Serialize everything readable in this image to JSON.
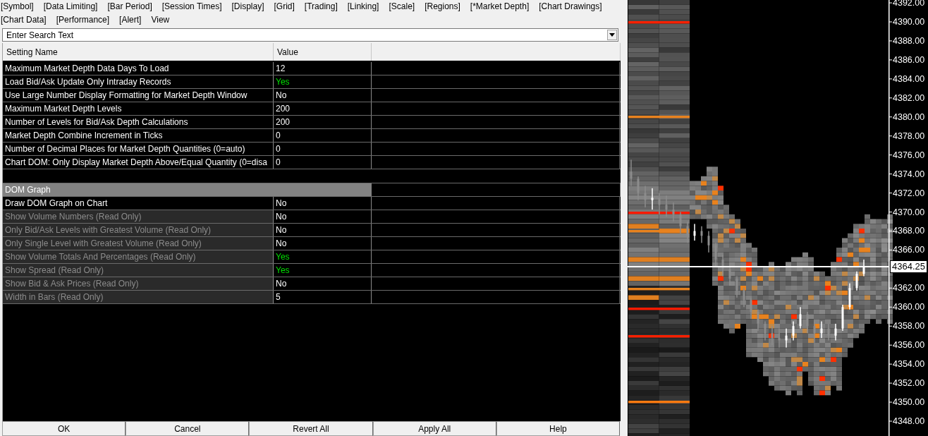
{
  "menu": {
    "rows": [
      [
        "[Symbol]",
        "[Data Limiting]",
        "[Bar Period]",
        "[Session Times]",
        "[Display]",
        "[Grid]",
        "[Trading]",
        "[Linking]",
        "[Scale]",
        "[Regions]",
        "[*Market Depth]",
        "[Chart Drawings]"
      ],
      [
        "[Chart Data]",
        "[Performance]",
        "[Alert]",
        "View"
      ]
    ]
  },
  "search": {
    "placeholder": "Enter Search Text"
  },
  "table": {
    "columns": [
      "Setting Name",
      "Value"
    ],
    "sections": [
      {
        "settings": [
          {
            "name": "Maximum Market Depth Data Days To Load",
            "value": "12",
            "color": "#ffffff",
            "read_only": false
          },
          {
            "name": "Load Bid/Ask Update Only Intraday Records",
            "value": "Yes",
            "color": "#00e000",
            "read_only": false
          },
          {
            "name": "Use Large Number Display Formatting for Market Depth Window",
            "value": "No",
            "color": "#ffffff",
            "read_only": false
          },
          {
            "name": "Maximum Market Depth Levels",
            "value": "200",
            "color": "#ffffff",
            "read_only": false
          },
          {
            "name": "Number of Levels for Bid/Ask Depth Calculations",
            "value": "200",
            "color": "#ffffff",
            "read_only": false
          },
          {
            "name": "Market Depth Combine Increment in Ticks",
            "value": "0",
            "color": "#ffffff",
            "read_only": false
          },
          {
            "name": "Number of Decimal Places for Market Depth Quantities (0=auto)",
            "value": "0",
            "color": "#ffffff",
            "read_only": false
          },
          {
            "name": "Chart DOM: Only Display Market Depth Above/Equal Quantity (0=disa",
            "value": "0",
            "color": "#ffffff",
            "read_only": false
          }
        ]
      },
      {
        "title": "DOM Graph",
        "settings": [
          {
            "name": "Draw DOM Graph on Chart",
            "value": "No",
            "color": "#ffffff",
            "read_only": false
          },
          {
            "name": "Show Volume Numbers (Read Only)",
            "value": "No",
            "color": "#ffffff",
            "read_only": true
          },
          {
            "name": "Only Bid/Ask Levels with Greatest Volume (Read Only)",
            "value": "No",
            "color": "#ffffff",
            "read_only": true
          },
          {
            "name": "Only Single Level with Greatest Volume (Read Only)",
            "value": "No",
            "color": "#ffffff",
            "read_only": true
          },
          {
            "name": "Show Volume Totals And Percentages (Read Only)",
            "value": "Yes",
            "color": "#00e000",
            "read_only": true
          },
          {
            "name": "Show Spread (Read Only)",
            "value": "Yes",
            "color": "#00e000",
            "read_only": true
          },
          {
            "name": "Show Bid & Ask Prices (Read Only)",
            "value": "No",
            "color": "#ffffff",
            "read_only": true
          },
          {
            "name": "Width in Bars (Read Only)",
            "value": "5",
            "color": "#ffffff",
            "read_only": true
          }
        ]
      }
    ]
  },
  "buttons": [
    "OK",
    "Cancel",
    "Revert All",
    "Apply All",
    "Help"
  ],
  "chart": {
    "chart_data": {
      "type": "candlestick",
      "ylim": [
        4346.44,
        4392.3
      ],
      "ref_lines": [
        {
          "axis": "y",
          "value": 4364.25,
          "label": "4364.25",
          "color": "#ffffff"
        }
      ],
      "yticks": [
        {
          "value": 4392,
          "label": "4392.00"
        },
        {
          "value": 4390,
          "label": "4390.00"
        },
        {
          "value": 4388,
          "label": "4388.00"
        },
        {
          "value": 4386,
          "label": "4386.00"
        },
        {
          "value": 4384,
          "label": "4384.00"
        },
        {
          "value": 4382,
          "label": "4382.00"
        },
        {
          "value": 4380,
          "label": "4380.00"
        },
        {
          "value": 4378,
          "label": "4378.00"
        },
        {
          "value": 4376,
          "label": "4376.00"
        },
        {
          "value": 4374,
          "label": "4374.00"
        },
        {
          "value": 4372,
          "label": "4372.00"
        },
        {
          "value": 4370,
          "label": "4370.00"
        },
        {
          "value": 4368,
          "label": "4368.00"
        },
        {
          "value": 4366,
          "label": "4366.00"
        },
        {
          "value": 4362,
          "label": "4362.00"
        },
        {
          "value": 4360,
          "label": "4360.00"
        },
        {
          "value": 4358,
          "label": "4358.00"
        },
        {
          "value": 4356,
          "label": "4356.00"
        },
        {
          "value": 4354,
          "label": "4354.00"
        },
        {
          "value": 4352,
          "label": "4352.00"
        },
        {
          "value": 4350,
          "label": "4350.00"
        },
        {
          "value": 4348,
          "label": "4348.00"
        }
      ],
      "categories": [
        null,
        null,
        null,
        null,
        null,
        null,
        null,
        null,
        null,
        null,
        null,
        null,
        null,
        null,
        null,
        null,
        null,
        null,
        null,
        null,
        null,
        null,
        null,
        null,
        null,
        null,
        null,
        null,
        null,
        null,
        null,
        null,
        null,
        null
      ],
      "ohlc": [
        [
          4374.25,
          4375.5,
          4372.75,
          4373.5
        ],
        [
          4373.5,
          4373.75,
          4371.25,
          4372.0
        ],
        [
          4372.0,
          4372.75,
          4370.5,
          4371.25
        ],
        [
          4371.25,
          4372.5,
          4370.25,
          4371.5
        ],
        [
          4371.5,
          4372.0,
          4369.75,
          4370.75
        ],
        [
          4370.75,
          4371.75,
          4369.5,
          4370.25
        ],
        [
          4370.25,
          4371.0,
          4369.0,
          4369.75
        ],
        [
          4369.75,
          4370.0,
          4367.75,
          4368.5
        ],
        [
          4368.5,
          4369.0,
          4366.75,
          4367.5
        ],
        [
          4367.5,
          4368.75,
          4367.0,
          4368.0
        ],
        [
          4368.0,
          4368.5,
          4366.75,
          4367.5
        ],
        [
          4367.5,
          4368.0,
          4365.75,
          4366.5
        ],
        [
          4366.5,
          4366.75,
          4364.25,
          4365.0
        ],
        [
          4365.0,
          4365.5,
          4363.25,
          4364.0
        ],
        [
          4364.0,
          4364.5,
          4362.25,
          4363.0
        ],
        [
          4363.0,
          4363.25,
          4361.0,
          4361.75
        ],
        [
          4361.75,
          4362.0,
          4360.0,
          4360.75
        ],
        [
          4360.75,
          4361.0,
          4358.75,
          4359.5
        ],
        [
          4359.5,
          4359.75,
          4357.5,
          4358.25
        ],
        [
          4358.25,
          4358.5,
          4356.5,
          4357.25
        ],
        [
          4357.25,
          4358.0,
          4356.0,
          4356.75
        ],
        [
          4356.75,
          4357.75,
          4355.75,
          4356.5
        ],
        [
          4356.5,
          4357.75,
          4355.75,
          4357.0
        ],
        [
          4357.0,
          4358.5,
          4356.5,
          4358.0
        ],
        [
          4358.0,
          4360.0,
          4357.75,
          4359.25
        ],
        [
          4359.25,
          4359.5,
          4357.25,
          4358.0
        ],
        [
          4358.0,
          4358.5,
          4356.25,
          4357.25
        ],
        [
          4357.25,
          4358.5,
          4356.75,
          4357.75
        ],
        [
          4357.75,
          4358.25,
          4356.5,
          4357.0
        ],
        [
          4357.0,
          4358.25,
          4356.5,
          4357.75
        ],
        [
          4357.75,
          4360.25,
          4357.5,
          4360.0
        ],
        [
          4360.0,
          4362.5,
          4359.75,
          4362.0
        ],
        [
          4362.0,
          4363.75,
          4361.75,
          4363.5
        ],
        [
          4363.5,
          4365.0,
          4363.25,
          4364.25
        ]
      ]
    }
  }
}
